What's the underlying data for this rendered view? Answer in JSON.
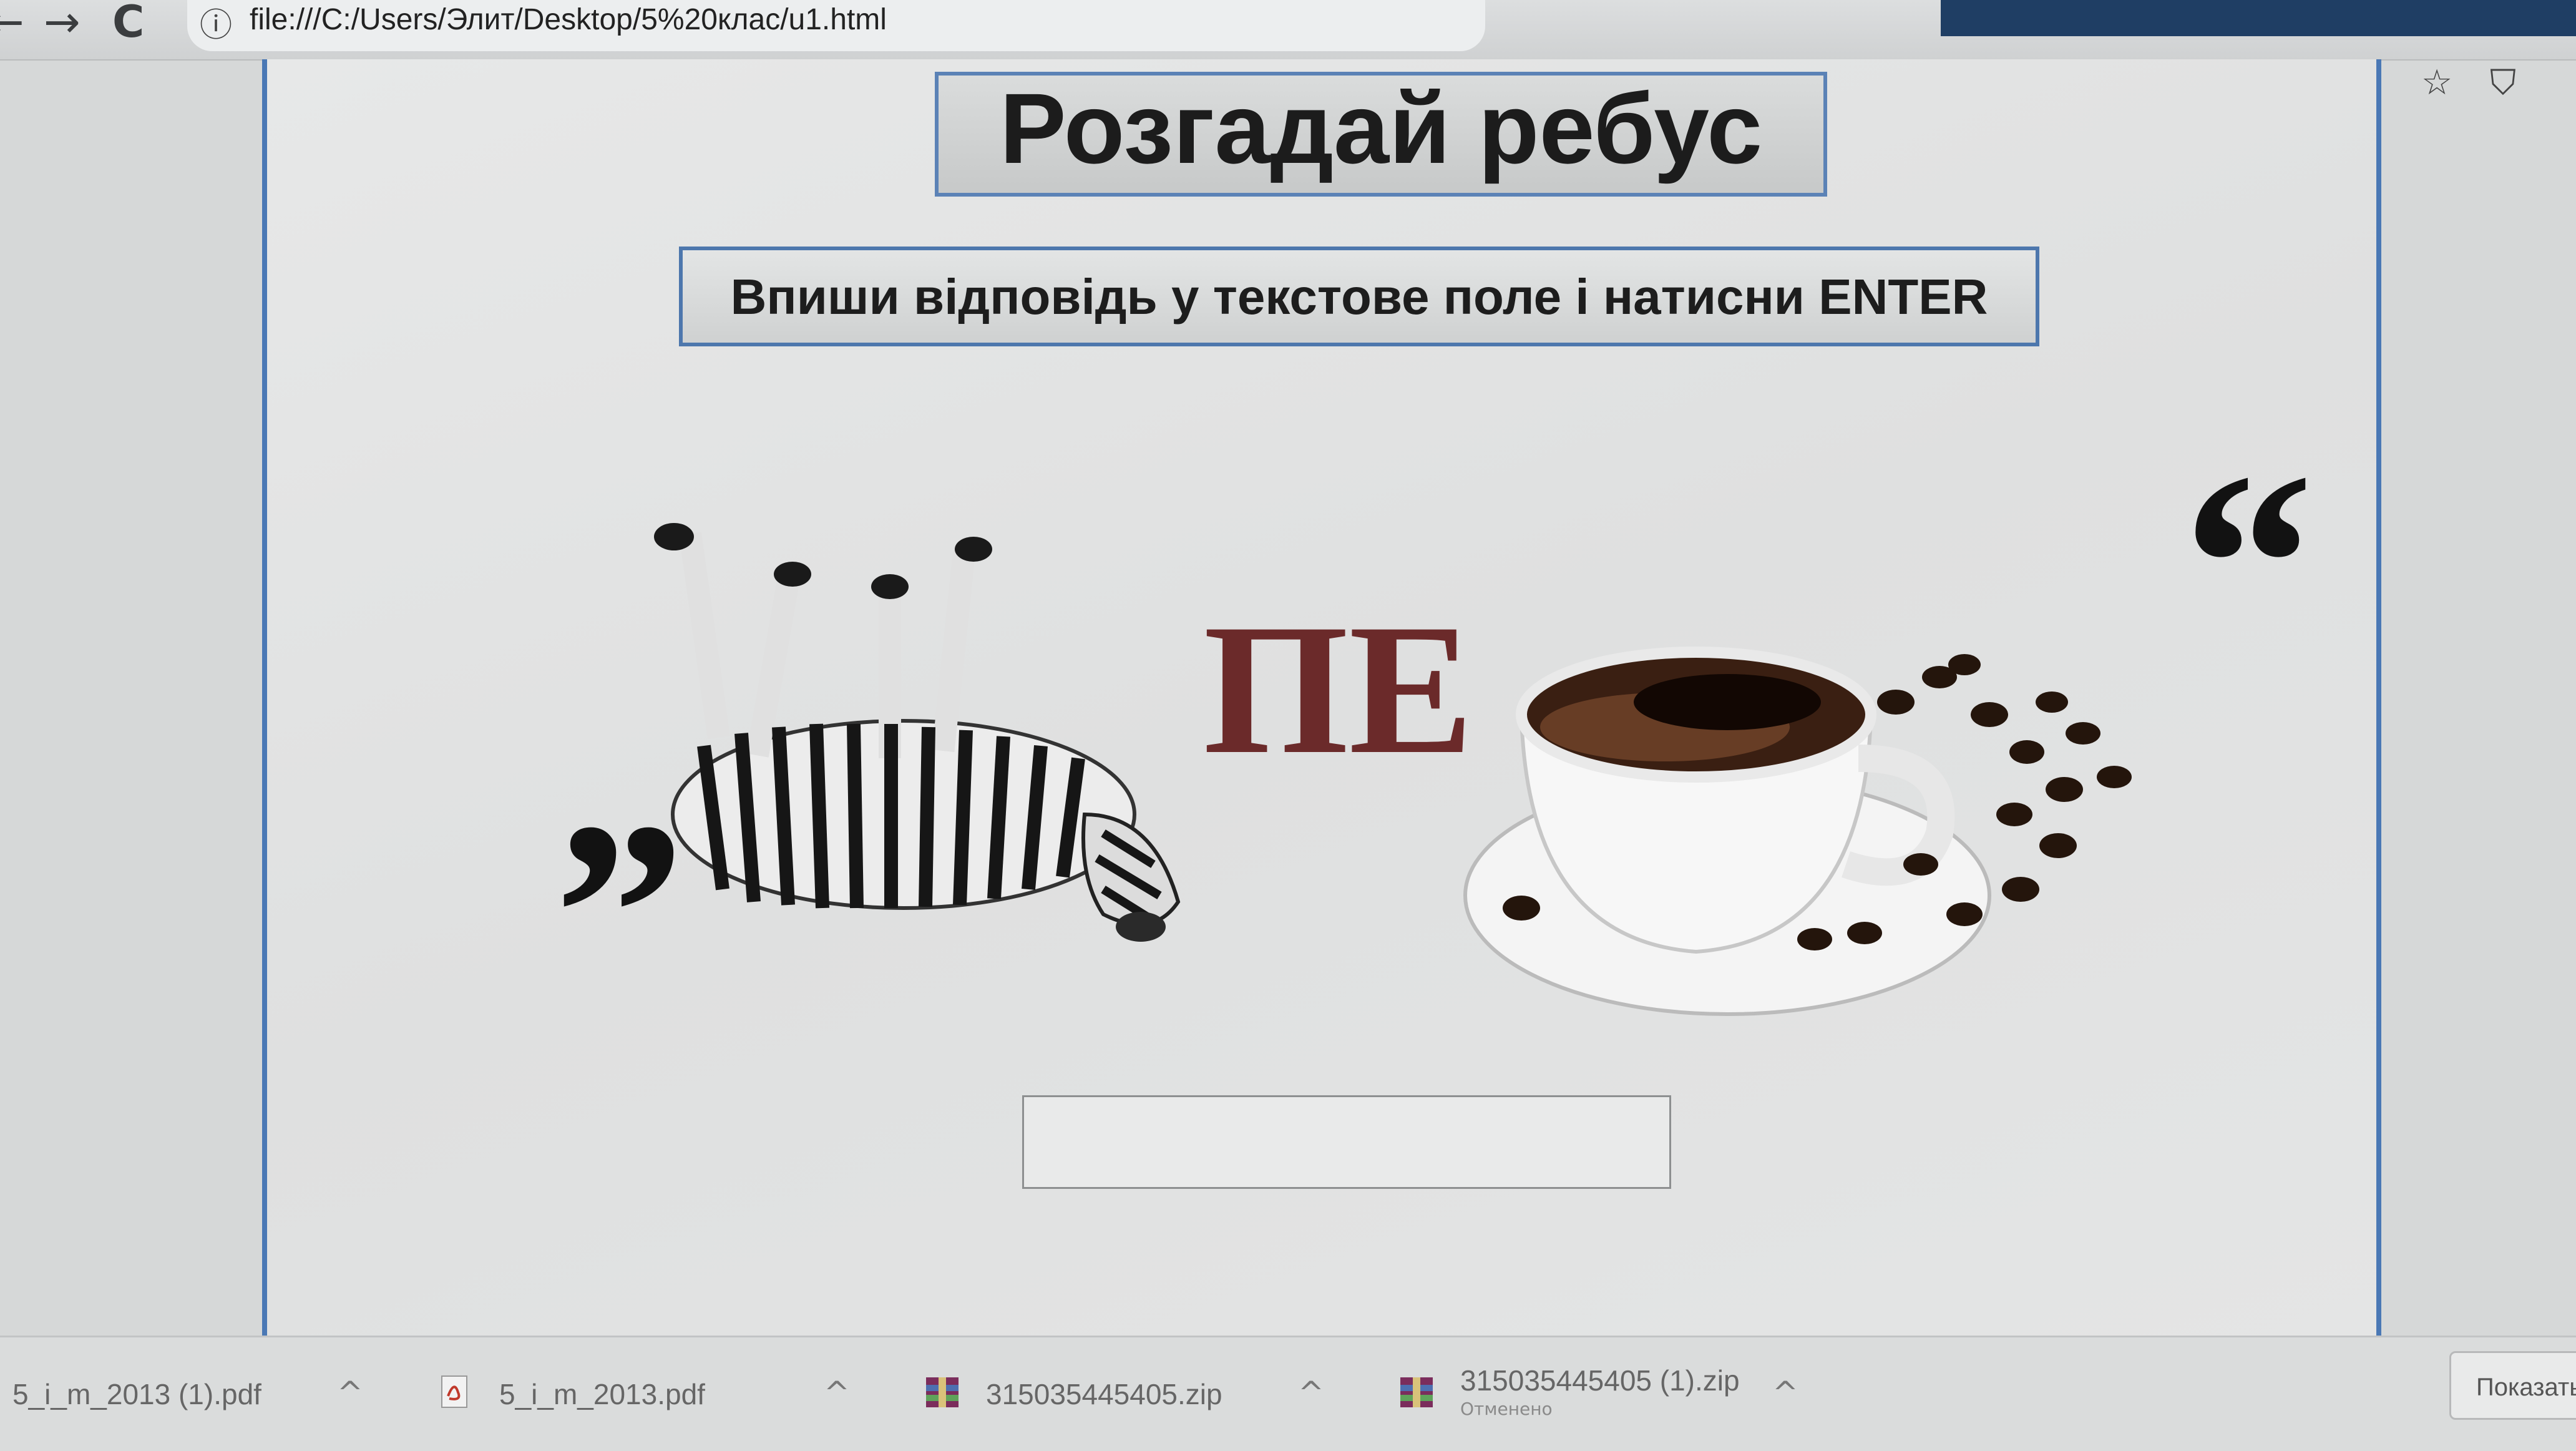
{
  "browser": {
    "back_glyph": "←",
    "forward_glyph": "→",
    "reload_glyph": "C",
    "info_glyph": "ⓘ",
    "url": "file:///C:/Users/Элит/Desktop/5%20клас/u1.html",
    "bookmark_glyph": "☆",
    "shield_glyph": "⛉"
  },
  "page": {
    "title": "Розгадай ребус",
    "instruction": "Впиши відповідь у текстове поле і натисни  ENTER",
    "rebus": {
      "open_quote": "”",
      "letters": "ПЕ",
      "close_quote": "“",
      "letters_color": "#6b2a2a"
    },
    "answer_value": "",
    "answer_placeholder": ""
  },
  "downloads": {
    "items": [
      {
        "name": "5_i_m_2013 (1).pdf",
        "type": "pdf-icon",
        "sub": ""
      },
      {
        "name": "5_i_m_2013.pdf",
        "type": "pdf-icon",
        "sub": ""
      },
      {
        "name": "315035445405.zip",
        "type": "archive-icon",
        "sub": ""
      },
      {
        "name": "315035445405 (1).zip",
        "type": "archive-icon",
        "sub": "Отменено"
      }
    ],
    "chevron_glyph": "^",
    "show_all_label": "Показать"
  },
  "colors": {
    "frame_border": "#4a78b5",
    "toolbar_tab": "#1f3e64"
  }
}
